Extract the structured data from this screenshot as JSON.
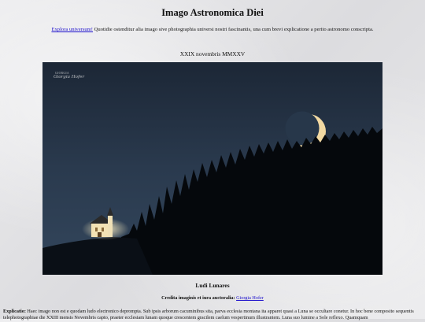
{
  "header": {
    "title": "Imago Astronomica Diei"
  },
  "intro": {
    "link_text": "Explora universum!",
    "text": " Quotidie ostenditur alia imago sive photographia universi nostri fascinantis, una cum brevi explicatione a perito astronomo conscripta."
  },
  "date": "XXIX novembris MMXXV",
  "photo": {
    "watermark_top": "GIORGIA",
    "watermark_signature": "Giorgia Hofer"
  },
  "caption": {
    "title": "Ludi Lunares",
    "credit_label": "Credita imaginis et iura auctoralia:",
    "credit_name": "Giorgia Hofer"
  },
  "explanation": {
    "label": "Explicatio:",
    "text": " Haec imago non est e quodam ludo electronico deprompta. Sub ipsis arborum cacuminibus sita, parva ecclesia montana ita apparet quasi a Luna se occultare conetur. In hoc bene composito sequentis telephotographiae die XXIII mensis Novembris capto, praeter ecclesiam lunam quoque crescentem gracilem caelum vespertinum illustrantem. Luna suo lumine a Sole reflexo. Quamquam"
  }
}
